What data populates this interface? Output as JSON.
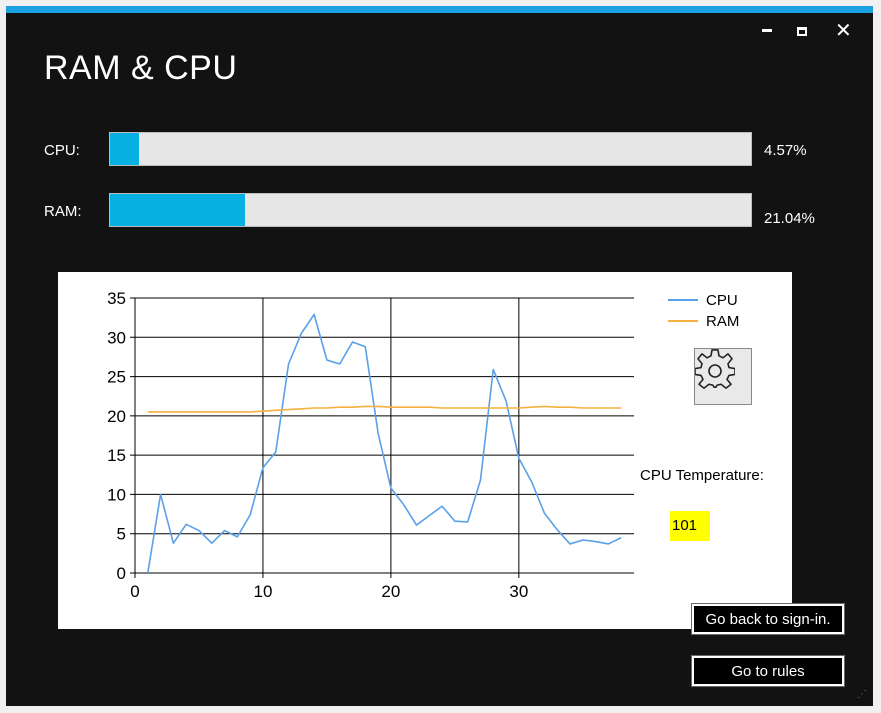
{
  "window": {
    "title": "RAM & CPU",
    "controls": {
      "minimize": "_",
      "maximize": "☐",
      "close": "✕"
    },
    "accent_color": "#1ba1e2"
  },
  "meters": {
    "cpu": {
      "label": "CPU:",
      "percent_text": "4.57%",
      "fraction": 0.0457
    },
    "ram": {
      "label": "RAM:",
      "percent_text": "21.04%",
      "fraction": 0.2104
    },
    "bar_color": "#06b0e0"
  },
  "settings_button": {
    "icon": "gear-icon"
  },
  "temperature": {
    "label": "CPU Temperature:",
    "value": "101",
    "highlight_color": "#ffff00"
  },
  "buttons": {
    "back": "Go back to sign-in.",
    "rules": "Go to rules"
  },
  "chart_data": {
    "type": "line",
    "xlim": [
      0,
      39
    ],
    "ylim": [
      0,
      35
    ],
    "x_ticks": [
      0,
      10,
      20,
      30
    ],
    "y_ticks": [
      0,
      5,
      10,
      15,
      20,
      25,
      30,
      35
    ],
    "grid": true,
    "legend": "top-right",
    "series": [
      {
        "name": "CPU",
        "color": "#5aa0e8",
        "x": [
          1,
          2,
          3,
          4,
          5,
          6,
          7,
          8,
          9,
          10,
          11,
          12,
          13,
          14,
          15,
          16,
          17,
          18,
          19,
          20,
          21,
          22,
          23,
          24,
          25,
          26,
          27,
          28,
          29,
          30,
          31,
          32,
          33,
          34,
          35,
          36,
          37,
          38
        ],
        "values": [
          0,
          10,
          3.8,
          6.2,
          5.4,
          3.8,
          5.4,
          4.6,
          7.4,
          13.4,
          15.4,
          26.6,
          30.5,
          32.9,
          27.1,
          26.6,
          29.4,
          28.8,
          17.8,
          10.8,
          8.7,
          6.1,
          7.3,
          8.5,
          6.6,
          6.5,
          11.8,
          25.9,
          21.9,
          14.6,
          11.6,
          7.6,
          5.5,
          3.7,
          4.2,
          4.0,
          3.7,
          4.5
        ]
      },
      {
        "name": "RAM",
        "color": "#f5b041",
        "x": [
          1,
          2,
          3,
          4,
          5,
          6,
          7,
          8,
          9,
          10,
          11,
          12,
          13,
          14,
          15,
          16,
          17,
          18,
          19,
          20,
          21,
          22,
          23,
          24,
          25,
          26,
          27,
          28,
          29,
          30,
          31,
          32,
          33,
          34,
          35,
          36,
          37,
          38
        ],
        "values": [
          20.5,
          20.5,
          20.5,
          20.5,
          20.5,
          20.5,
          20.5,
          20.5,
          20.5,
          20.6,
          20.7,
          20.8,
          20.9,
          21.0,
          21.0,
          21.1,
          21.1,
          21.2,
          21.2,
          21.1,
          21.1,
          21.1,
          21.1,
          21.0,
          21.0,
          21.0,
          21.0,
          21.0,
          21.0,
          21.0,
          21.1,
          21.2,
          21.1,
          21.1,
          21.0,
          21.0,
          21.0,
          21.0
        ]
      }
    ]
  }
}
